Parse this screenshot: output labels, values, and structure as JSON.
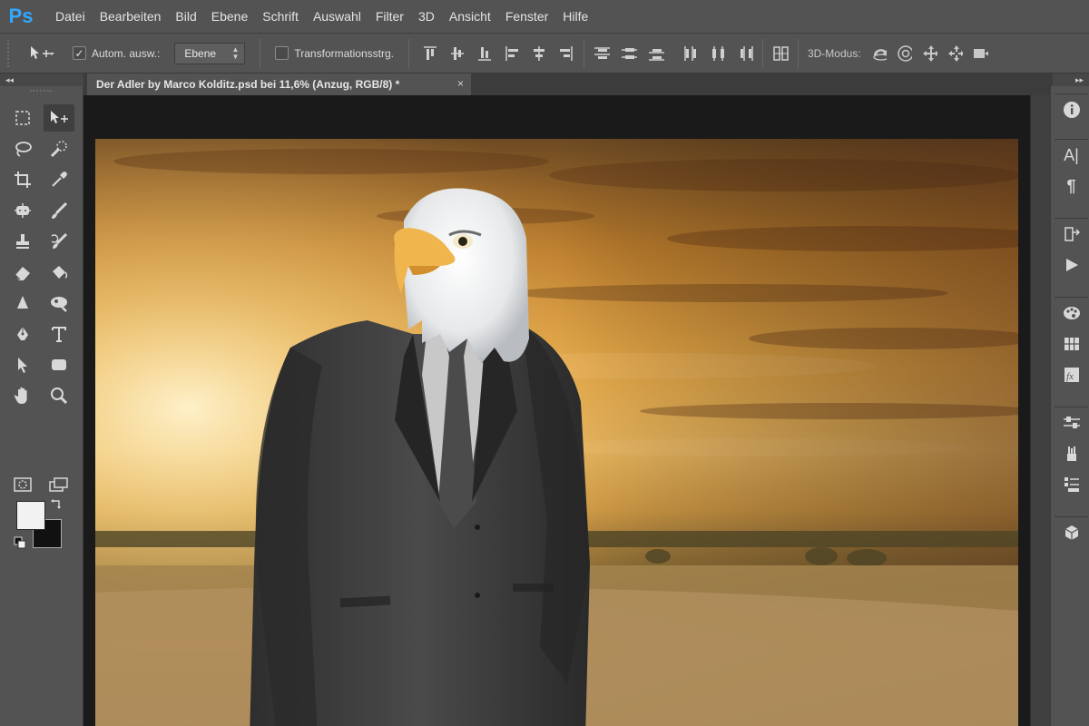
{
  "app": {
    "logo": "Ps",
    "accent": "#31a8ff"
  },
  "menu": [
    "Datei",
    "Bearbeiten",
    "Bild",
    "Ebene",
    "Schrift",
    "Auswahl",
    "Filter",
    "3D",
    "Ansicht",
    "Fenster",
    "Hilfe"
  ],
  "options": {
    "tool_icon": "move-tool-icon",
    "auto_select_label": "Autom. ausw.:",
    "auto_select_checked": true,
    "auto_select_target": "Ebene",
    "transform_label": "Transformationsstrg.",
    "transform_checked": false,
    "mode_3d_label": "3D-Modus:"
  },
  "tabs": {
    "collapse_left": "◂◂",
    "collapse_right": "▸▸",
    "document_title": "Der Adler by Marco Kolditz.psd bei 11,6% (Anzug, RGB/8) *",
    "close": "×"
  },
  "tools": [
    "rectangular-marquee",
    "move",
    "lasso",
    "quick-selection",
    "crop",
    "eyedropper",
    "spot-healing-brush",
    "brush",
    "clone-stamp",
    "history-brush",
    "eraser",
    "paint-bucket",
    "blur",
    "dodge",
    "pen",
    "type",
    "path-selection",
    "rectangle",
    "hand",
    "zoom",
    "quick-mask",
    "screen-mode"
  ],
  "colors": {
    "foreground": "#f2f2f2",
    "background": "#111111"
  },
  "right_panels": [
    "info-icon",
    "character-icon",
    "paragraph-icon",
    "history-icon",
    "actions-icon",
    "color-icon",
    "swatches-icon",
    "styles-icon",
    "adjustments-icon",
    "brush-presets-icon",
    "layers-icon",
    "3d-icon"
  ],
  "typography": {
    "paragraph_glyph": "¶",
    "character_glyph": "A|",
    "info_glyph": "i",
    "styles_glyph": "fx"
  }
}
